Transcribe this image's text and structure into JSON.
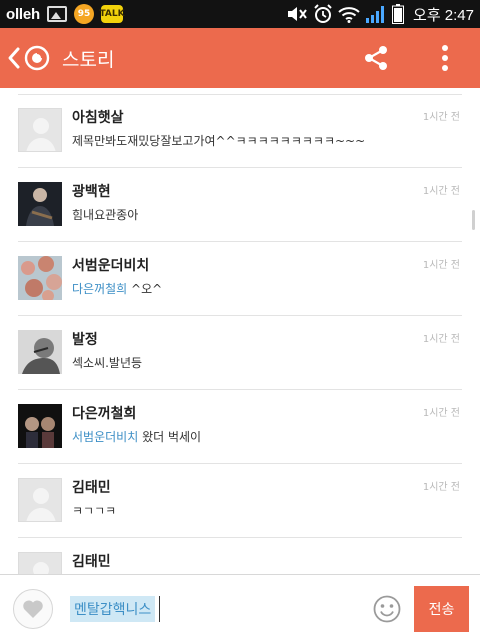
{
  "status_bar": {
    "carrier": "olleh",
    "clock": "오후 2:47",
    "badge_number": "95",
    "talk_label": "TALK"
  },
  "app_bar": {
    "title": "스토리"
  },
  "comments": [
    {
      "name": "아침햇살",
      "time": "1시간 전",
      "mention": "",
      "text": "제목만봐도재밌당잘보고가여^^ㅋㅋㅋㅋㅋㅋㅋㅋㅋ~~~",
      "avatar": "blank"
    },
    {
      "name": "광백현",
      "time": "1시간 전",
      "mention": "",
      "text": "힘내요관종아",
      "avatar": "photo-dark-guitar"
    },
    {
      "name": "서범운더비치",
      "time": "1시간 전",
      "mention": "다은꺼철희",
      "text": " ^오^",
      "avatar": "photo-blossom"
    },
    {
      "name": "발정",
      "time": "1시간 전",
      "mention": "",
      "text": "섹소씨.발년등",
      "avatar": "photo-grayscale"
    },
    {
      "name": "다은꺼철희",
      "time": "1시간 전",
      "mention": "서범운더비치",
      "text": " 왔더 벅세이",
      "avatar": "photo-dark-couple"
    },
    {
      "name": "김태민",
      "time": "1시간 전",
      "mention": "",
      "text": "ㅋㄱㄱㅋ",
      "avatar": "blank"
    },
    {
      "name": "김태민",
      "time": "",
      "mention": "",
      "text": "",
      "avatar": "blank"
    }
  ],
  "input": {
    "mention_chip": "멘탈갑핵니스",
    "send_label": "전송"
  },
  "colors": {
    "accent": "#ec6a4d",
    "mention": "#3d8fc6",
    "status_bar": "#121212"
  },
  "icons": {
    "back": "chevron-left-icon",
    "logo": "story-logo-icon",
    "share": "share-icon",
    "more": "more-vertical-icon",
    "like": "heart-icon",
    "emoji": "smiley-icon"
  }
}
